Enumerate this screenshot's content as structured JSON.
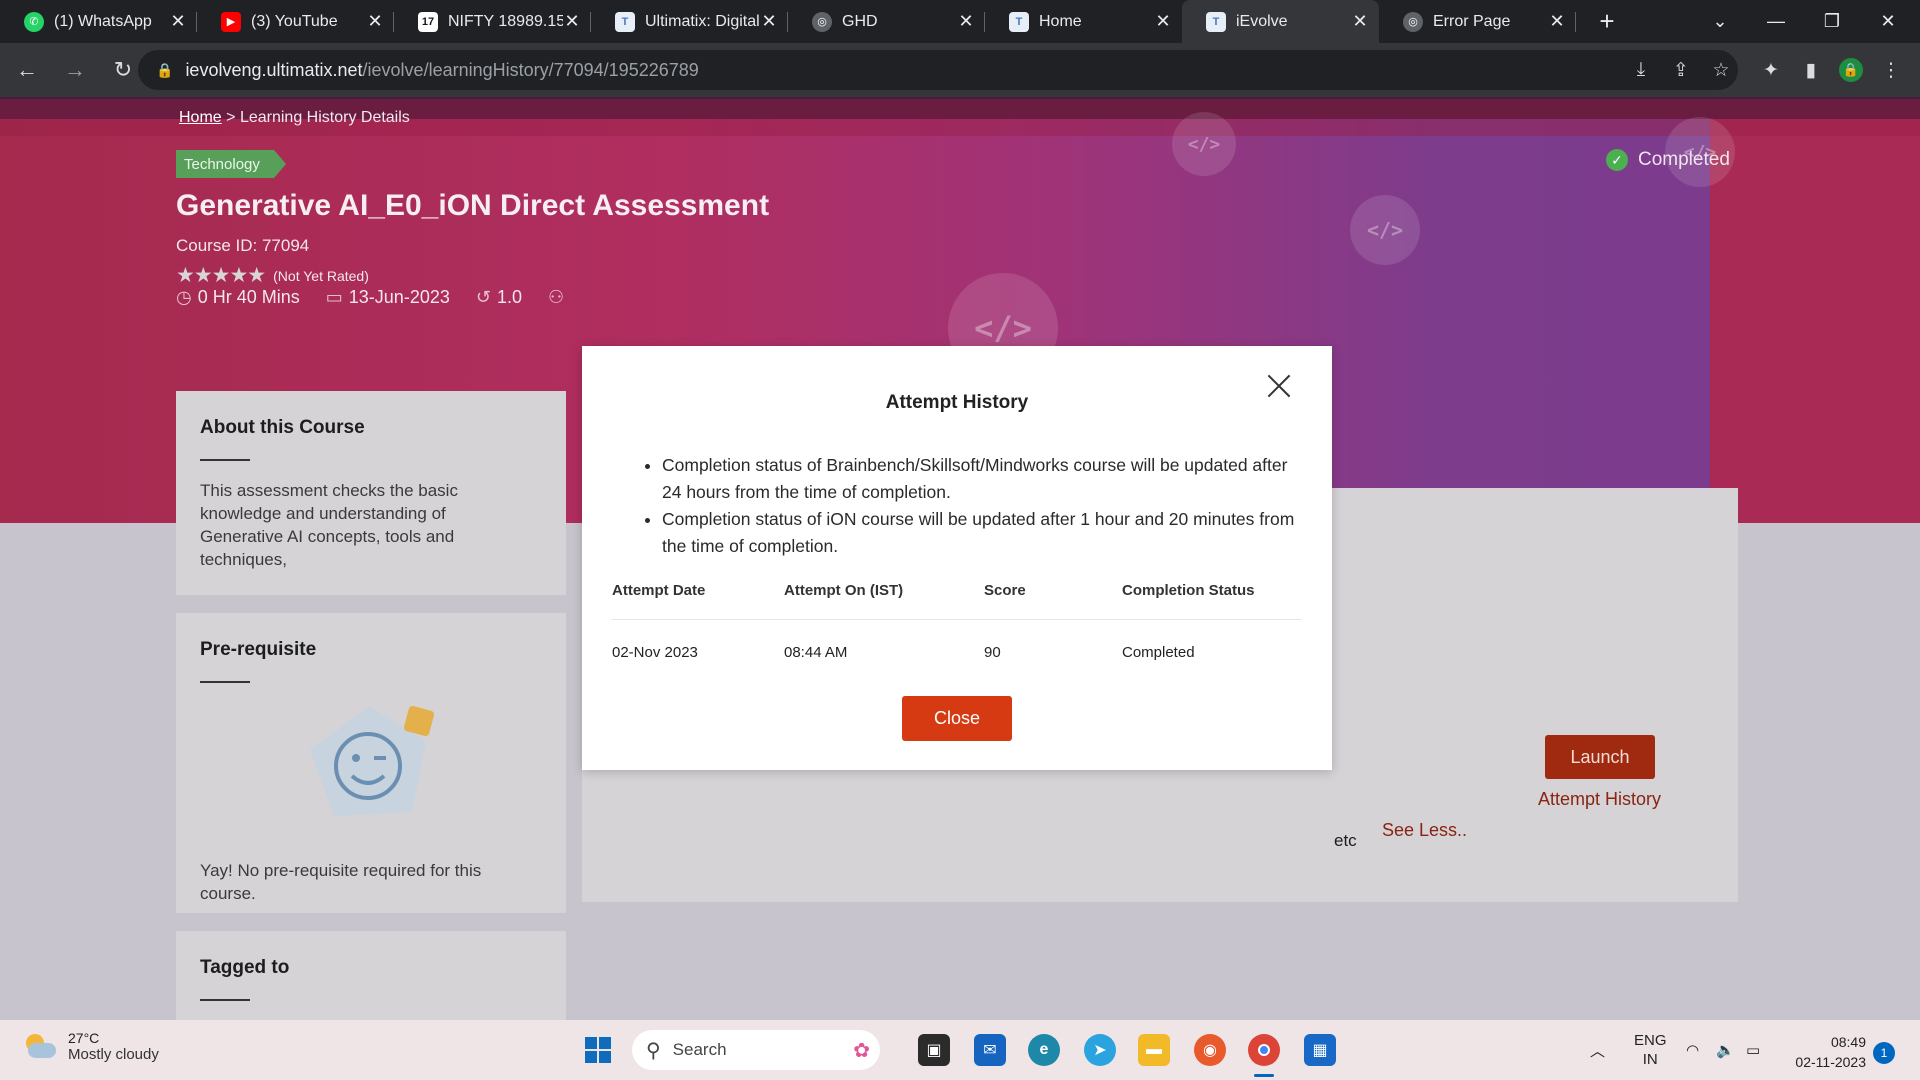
{
  "browser": {
    "tabs": [
      {
        "title": "(1) WhatsApp",
        "icon": "whatsapp-icon",
        "color": "#25d366"
      },
      {
        "title": "(3) YouTube",
        "icon": "youtube-icon",
        "color": "#ff0000"
      },
      {
        "title": "NIFTY 18989.15",
        "icon": "tradingview-icon",
        "color": "#131722"
      },
      {
        "title": "Ultimatix: Digital",
        "icon": "tata-icon",
        "color": "#4a7ab8"
      },
      {
        "title": "GHD",
        "icon": "globe-icon",
        "color": "#5f6368"
      },
      {
        "title": "Home",
        "icon": "tata-icon",
        "color": "#4a7ab8"
      },
      {
        "title": "iEvolve",
        "icon": "tata-icon",
        "color": "#4a7ab8"
      },
      {
        "title": "Error Page",
        "icon": "globe-icon",
        "color": "#5f6368"
      }
    ],
    "active_tab": 6,
    "url_host": "ievolveng.ultimatix.net",
    "url_path": "/ievolve/learningHistory/77094/195226789"
  },
  "breadcrumb": {
    "home": "Home",
    "separator": ">",
    "current": "Learning History Details"
  },
  "course": {
    "category": "Technology",
    "status": "Completed",
    "title": "Generative AI_E0_iON Direct Assessment",
    "id_label": "Course ID: 77094",
    "rating_text": "(Not Yet Rated)",
    "stars": "★★★★★",
    "duration": "0 Hr 40 Mins",
    "date": "13-Jun-2023",
    "version": "1.0"
  },
  "about": {
    "heading": "About this Course",
    "text": "This assessment checks the basic knowledge and understanding of Generative AI concepts, tools and techniques,"
  },
  "prereq": {
    "heading": "Pre-requisite",
    "text": "Yay! No pre-requisite required for this course."
  },
  "tagged": {
    "heading": "Tagged to"
  },
  "actions": {
    "launch": "Launch",
    "attempt_history": "Attempt History",
    "see_less": "See Less..",
    "etc": "etc"
  },
  "modal": {
    "title": "Attempt History",
    "notes": [
      "Completion status of Brainbench/Skillsoft/Mindworks course will be updated after 24 hours from the time of completion.",
      "Completion status of iON course will be updated after 1 hour and 20 minutes from the time of completion."
    ],
    "columns": [
      "Attempt Date",
      "Attempt On (IST)",
      "Score",
      "Completion Status"
    ],
    "rows": [
      [
        "02-Nov 2023",
        "08:44 AM",
        "90",
        "Completed"
      ]
    ],
    "close_label": "Close"
  },
  "taskbar": {
    "weather_temp": "27°C",
    "weather_desc": "Mostly cloudy",
    "search_label": "Search",
    "lang_line1": "ENG",
    "lang_line2": "IN",
    "time": "08:49",
    "date": "02-11-2023",
    "notification_count": "1"
  }
}
